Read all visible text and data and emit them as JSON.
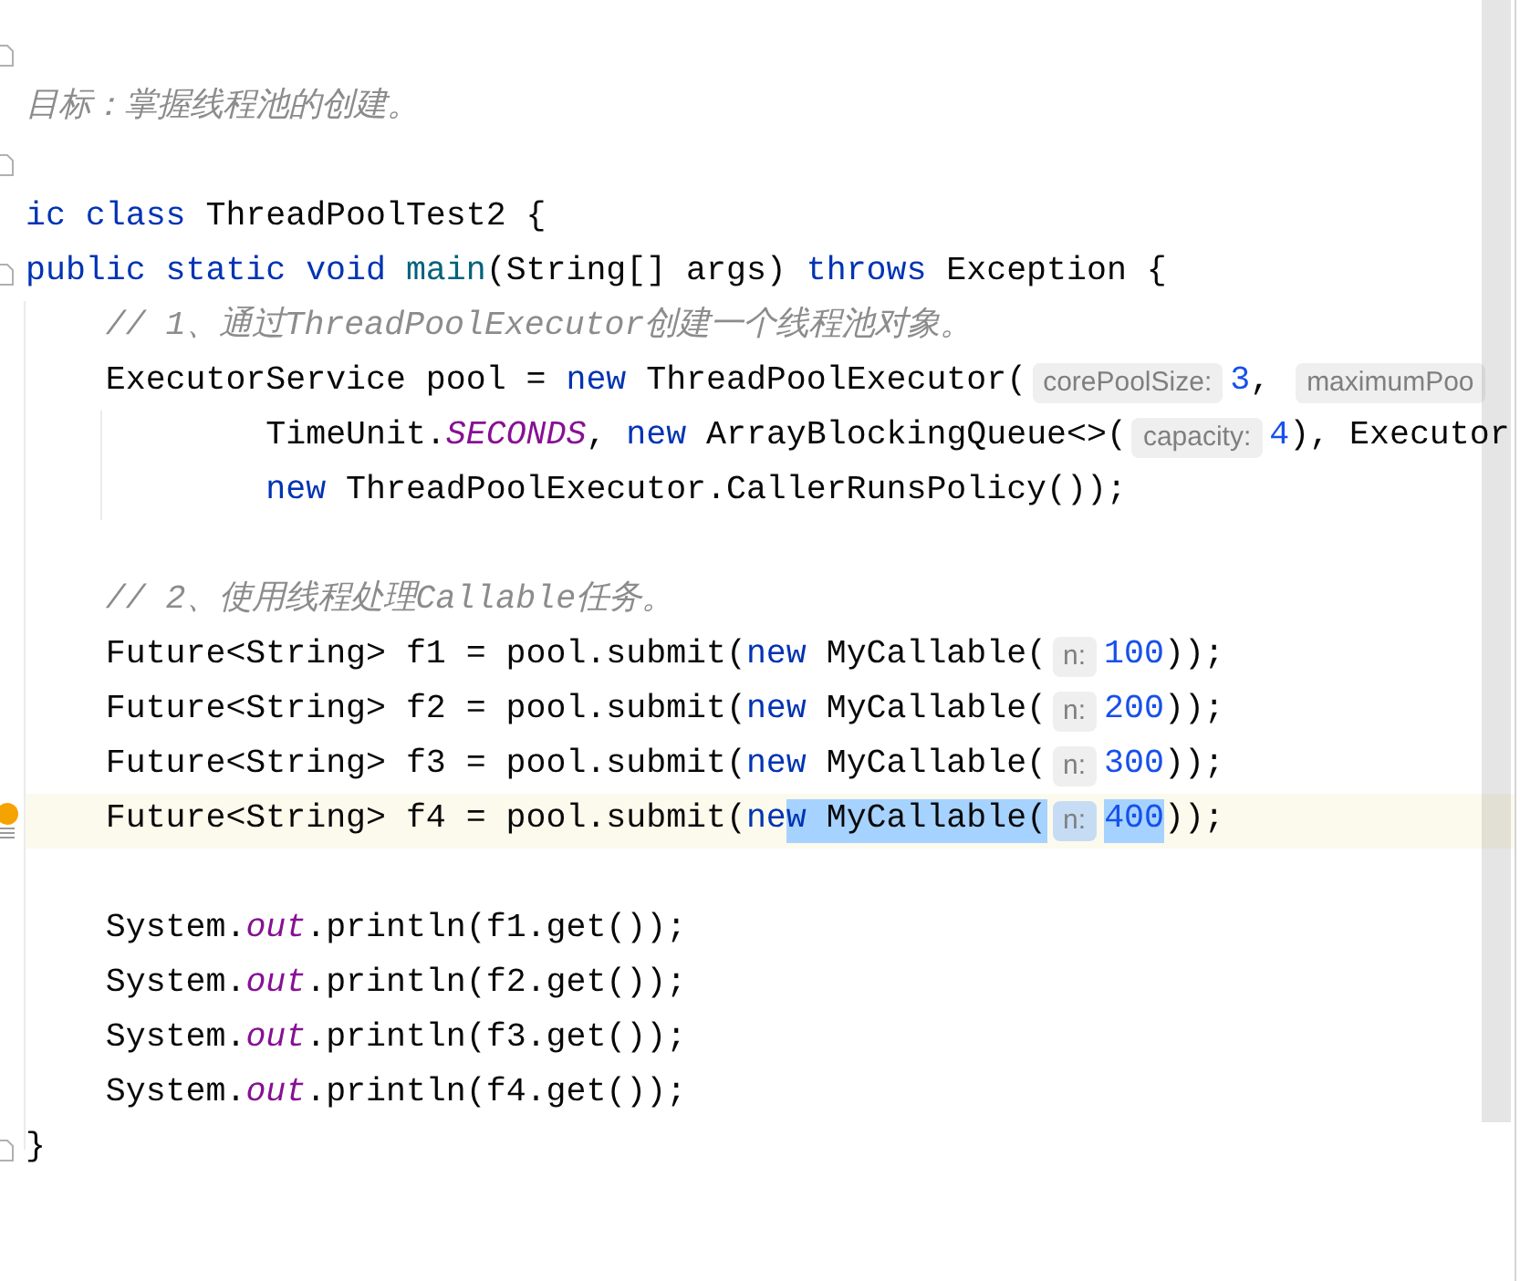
{
  "editor": {
    "lines": [
      {
        "current": false,
        "gutter": {
          "kind": "fold"
        }
      },
      {
        "current": false,
        "tokens": [
          {
            "kind": "comment",
            "text": "目标：掌握线程池的创建。"
          }
        ]
      },
      {
        "current": false,
        "gutter": {
          "kind": "fold"
        }
      },
      {
        "current": false,
        "tokens": [
          {
            "kind": "keyword",
            "text": "ic class"
          },
          {
            "kind": "plain",
            "text": " ThreadPoolTest2 {"
          }
        ]
      },
      {
        "current": false,
        "gutter": {
          "kind": "fold"
        },
        "tokens": [
          {
            "kind": "keyword",
            "text": "public static void "
          },
          {
            "kind": "method",
            "text": "main"
          },
          {
            "kind": "plain",
            "text": "(String[] args) "
          },
          {
            "kind": "keyword",
            "text": "throws"
          },
          {
            "kind": "plain",
            "text": " Exception {"
          }
        ]
      },
      {
        "current": false,
        "tokens": [
          {
            "kind": "comment",
            "text": "    // 1、通过ThreadPoolExecutor创建一个线程池对象。"
          }
        ]
      },
      {
        "current": false,
        "tokens": [
          {
            "kind": "plain",
            "text": "    ExecutorService pool = "
          },
          {
            "kind": "keyword",
            "text": "new"
          },
          {
            "kind": "plain",
            "text": " ThreadPoolExecutor("
          },
          {
            "kind": "hint",
            "text": "corePoolSize:"
          },
          {
            "kind": "number",
            "text": "3"
          },
          {
            "kind": "plain",
            "text": ", "
          },
          {
            "kind": "hint",
            "text": "maximumPoo"
          }
        ]
      },
      {
        "current": false,
        "tokens": [
          {
            "kind": "plain",
            "text": "            TimeUnit."
          },
          {
            "kind": "field",
            "text": "SECONDS"
          },
          {
            "kind": "plain",
            "text": ", "
          },
          {
            "kind": "keyword",
            "text": "new"
          },
          {
            "kind": "plain",
            "text": " ArrayBlockingQueue<>("
          },
          {
            "kind": "hint",
            "text": "capacity:"
          },
          {
            "kind": "number",
            "text": "4"
          },
          {
            "kind": "plain",
            "text": "), Executor"
          }
        ]
      },
      {
        "current": false,
        "tokens": [
          {
            "kind": "keyword",
            "text": "            new"
          },
          {
            "kind": "plain",
            "text": " ThreadPoolExecutor.CallerRunsPolicy());"
          }
        ]
      },
      {
        "current": false
      },
      {
        "current": false,
        "tokens": [
          {
            "kind": "comment",
            "text": "    // 2、使用线程处理Callable任务。"
          }
        ]
      },
      {
        "current": false,
        "tokens": [
          {
            "kind": "plain",
            "text": "    Future<String> f1 = pool.submit("
          },
          {
            "kind": "keyword",
            "text": "new"
          },
          {
            "kind": "plain",
            "text": " MyCallable("
          },
          {
            "kind": "hint",
            "text": "n:"
          },
          {
            "kind": "number",
            "text": "100"
          },
          {
            "kind": "plain",
            "text": "));"
          }
        ]
      },
      {
        "current": false,
        "tokens": [
          {
            "kind": "plain",
            "text": "    Future<String> f2 = pool.submit("
          },
          {
            "kind": "keyword",
            "text": "new"
          },
          {
            "kind": "plain",
            "text": " MyCallable("
          },
          {
            "kind": "hint",
            "text": "n:"
          },
          {
            "kind": "number",
            "text": "200"
          },
          {
            "kind": "plain",
            "text": "));"
          }
        ]
      },
      {
        "current": false,
        "tokens": [
          {
            "kind": "plain",
            "text": "    Future<String> f3 = pool.submit("
          },
          {
            "kind": "keyword",
            "text": "new"
          },
          {
            "kind": "plain",
            "text": " MyCallable("
          },
          {
            "kind": "hint",
            "text": "n:"
          },
          {
            "kind": "number",
            "text": "300"
          },
          {
            "kind": "plain",
            "text": "));"
          }
        ]
      },
      {
        "current": true,
        "gutter": {
          "kind": "bulb"
        },
        "tokens": [
          {
            "kind": "plain",
            "text": "    Future<String> f4 = pool.submit(",
            "selected": false
          },
          {
            "kind": "keyword",
            "text": "ne",
            "selected": false
          },
          {
            "kind": "keyword",
            "text": "w",
            "selected": true
          },
          {
            "kind": "plain",
            "text": " MyCallable(",
            "selected": true
          },
          {
            "kind": "hint",
            "text": "n:",
            "selected": true
          },
          {
            "kind": "number",
            "text": "400",
            "selected": true
          },
          {
            "kind": "plain",
            "text": "));",
            "selected": false
          }
        ]
      },
      {
        "current": false
      },
      {
        "current": false,
        "tokens": [
          {
            "kind": "plain",
            "text": "    System."
          },
          {
            "kind": "field",
            "text": "out"
          },
          {
            "kind": "plain",
            "text": ".println(f1.get());"
          }
        ]
      },
      {
        "current": false,
        "tokens": [
          {
            "kind": "plain",
            "text": "    System."
          },
          {
            "kind": "field",
            "text": "out"
          },
          {
            "kind": "plain",
            "text": ".println(f2.get());"
          }
        ]
      },
      {
        "current": false,
        "tokens": [
          {
            "kind": "plain",
            "text": "    System."
          },
          {
            "kind": "field",
            "text": "out"
          },
          {
            "kind": "plain",
            "text": ".println(f3.get());"
          }
        ]
      },
      {
        "current": false,
        "tokens": [
          {
            "kind": "plain",
            "text": "    System."
          },
          {
            "kind": "field",
            "text": "out"
          },
          {
            "kind": "plain",
            "text": ".println(f4.get());"
          }
        ]
      },
      {
        "current": false,
        "gutter": {
          "kind": "fold"
        },
        "tokens": [
          {
            "kind": "plain",
            "text": "}"
          }
        ]
      }
    ]
  }
}
